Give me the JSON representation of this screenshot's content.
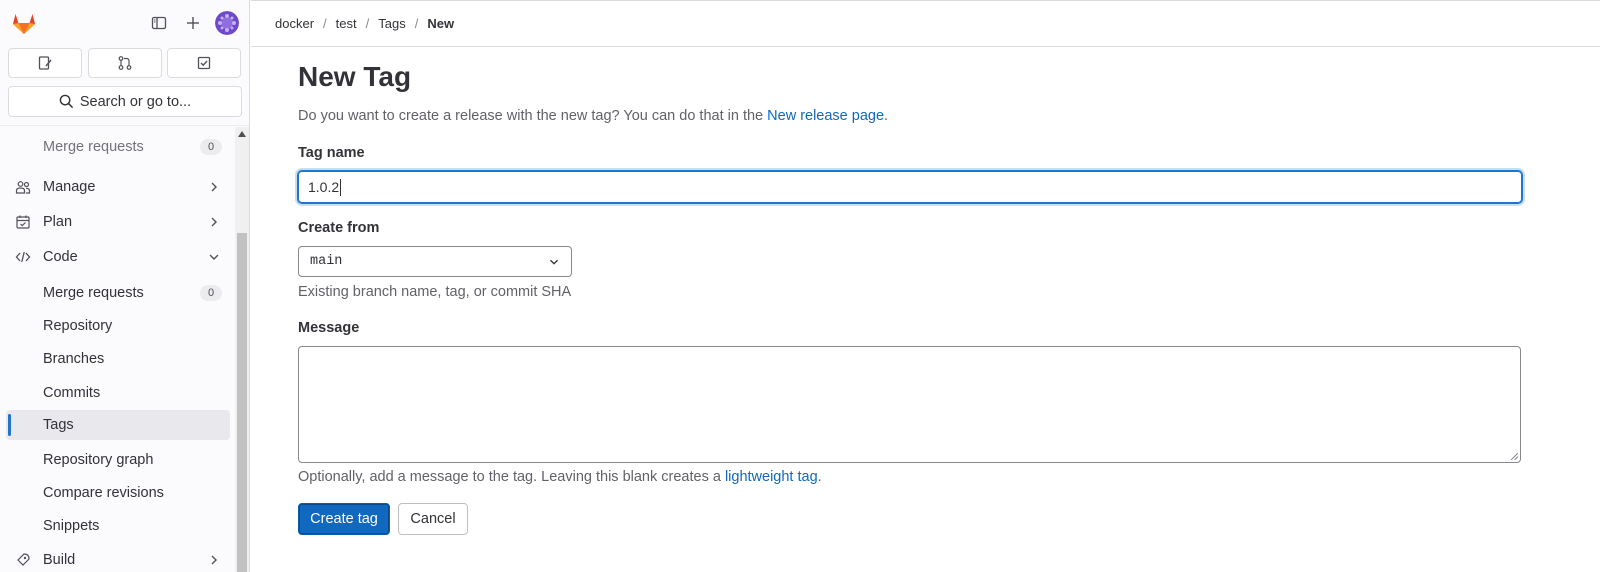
{
  "sidebar": {
    "search_label": "Search or go to...",
    "items": [
      {
        "label": "Merge requests",
        "badge": "0"
      },
      {
        "label": "Manage"
      },
      {
        "label": "Plan"
      },
      {
        "label": "Code"
      },
      {
        "label": "Merge requests",
        "badge": "0"
      },
      {
        "label": "Repository"
      },
      {
        "label": "Branches"
      },
      {
        "label": "Commits"
      },
      {
        "label": "Tags"
      },
      {
        "label": "Repository graph"
      },
      {
        "label": "Compare revisions"
      },
      {
        "label": "Snippets"
      },
      {
        "label": "Build"
      }
    ]
  },
  "breadcrumb": [
    "docker",
    "test",
    "Tags",
    "New"
  ],
  "page": {
    "title": "New Tag",
    "intro_text": "Do you want to create a release with the new tag? You can do that in the ",
    "intro_link": "New release page",
    "intro_end": ".",
    "tag_name_label": "Tag name",
    "tag_name_value": "1.0.2",
    "create_from_label": "Create from",
    "create_from_value": "main",
    "create_from_help": "Existing branch name, tag, or commit SHA",
    "message_label": "Message",
    "message_help_text": "Optionally, add a message to the tag. Leaving this blank creates a ",
    "message_help_link": "lightweight tag",
    "message_help_end": ".",
    "create_button": "Create tag",
    "cancel_button": "Cancel"
  },
  "colors": {
    "accent": "#1068bf",
    "active_indicator": "#1f75cb"
  },
  "icons": {
    "logo": "gitlab-tanuki-logo",
    "sidebar_toggle": "sidebar-icon",
    "new": "plus-icon",
    "quick_actions": [
      "issues-icon",
      "merge-request-icon",
      "todo-icon"
    ],
    "search": "search-icon"
  }
}
